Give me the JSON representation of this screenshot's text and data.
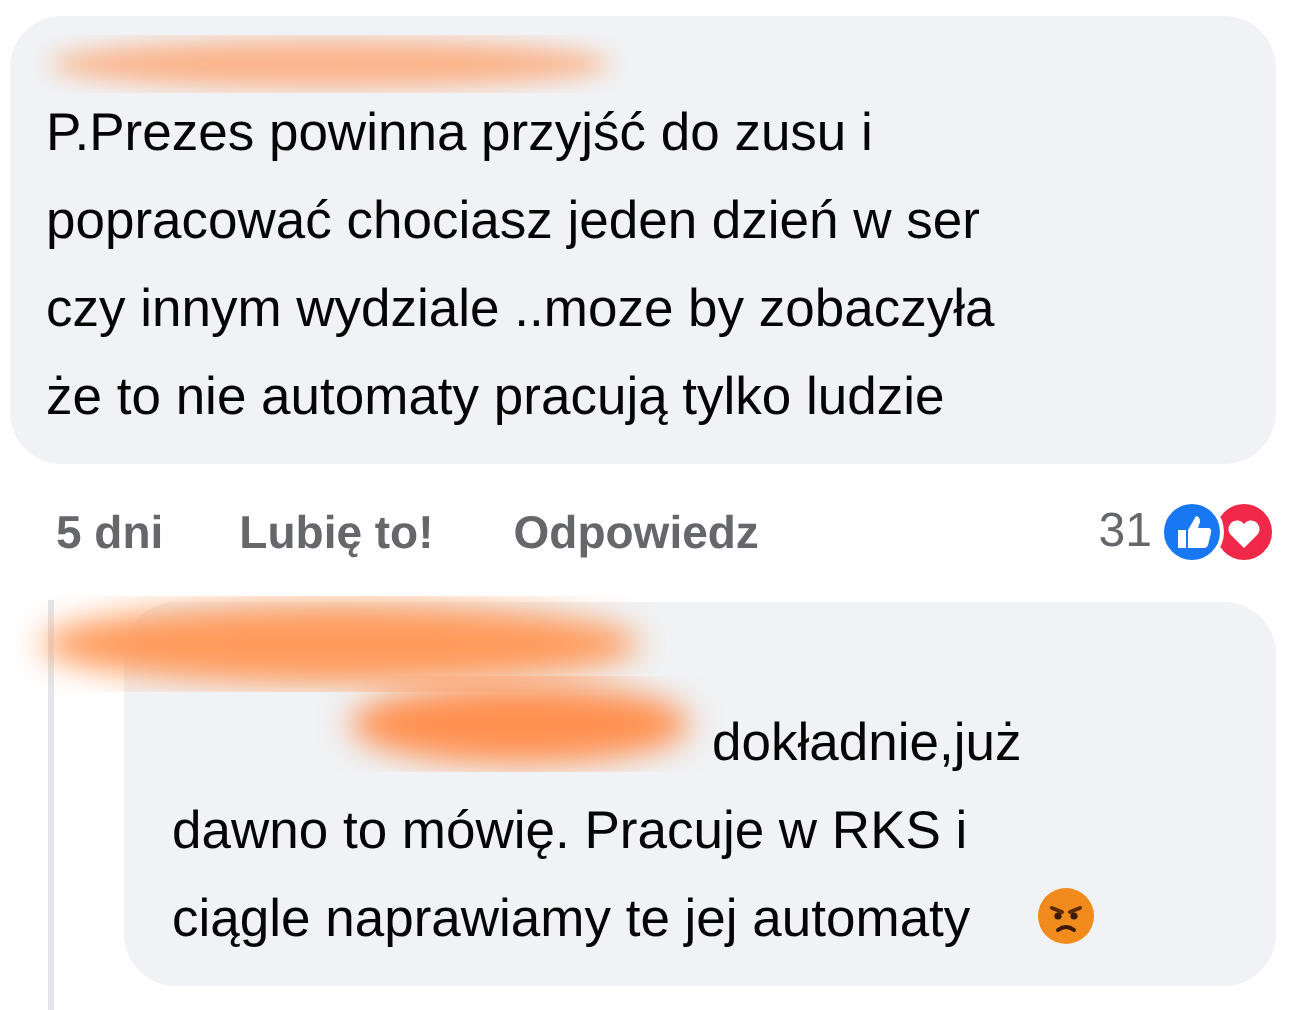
{
  "comments": [
    {
      "lines": [
        "P.Prezes powinna przyjść do zusu i",
        "popracować chociasz jeden dzień w ser",
        "czy innym wydziale  ..moze by zobaczyła",
        "że to nie automaty pracują tylko ludzie"
      ],
      "time": "5 dni",
      "like_label": "Lubię to!",
      "reply_label": "Odpowiedz",
      "reaction_count": "31"
    },
    {
      "lines": [
        "dokładnie,już",
        "dawno to mówię. Pracuje w RKS i",
        "ciągle naprawiamy te jej automaty"
      ],
      "kind": "reply"
    }
  ]
}
